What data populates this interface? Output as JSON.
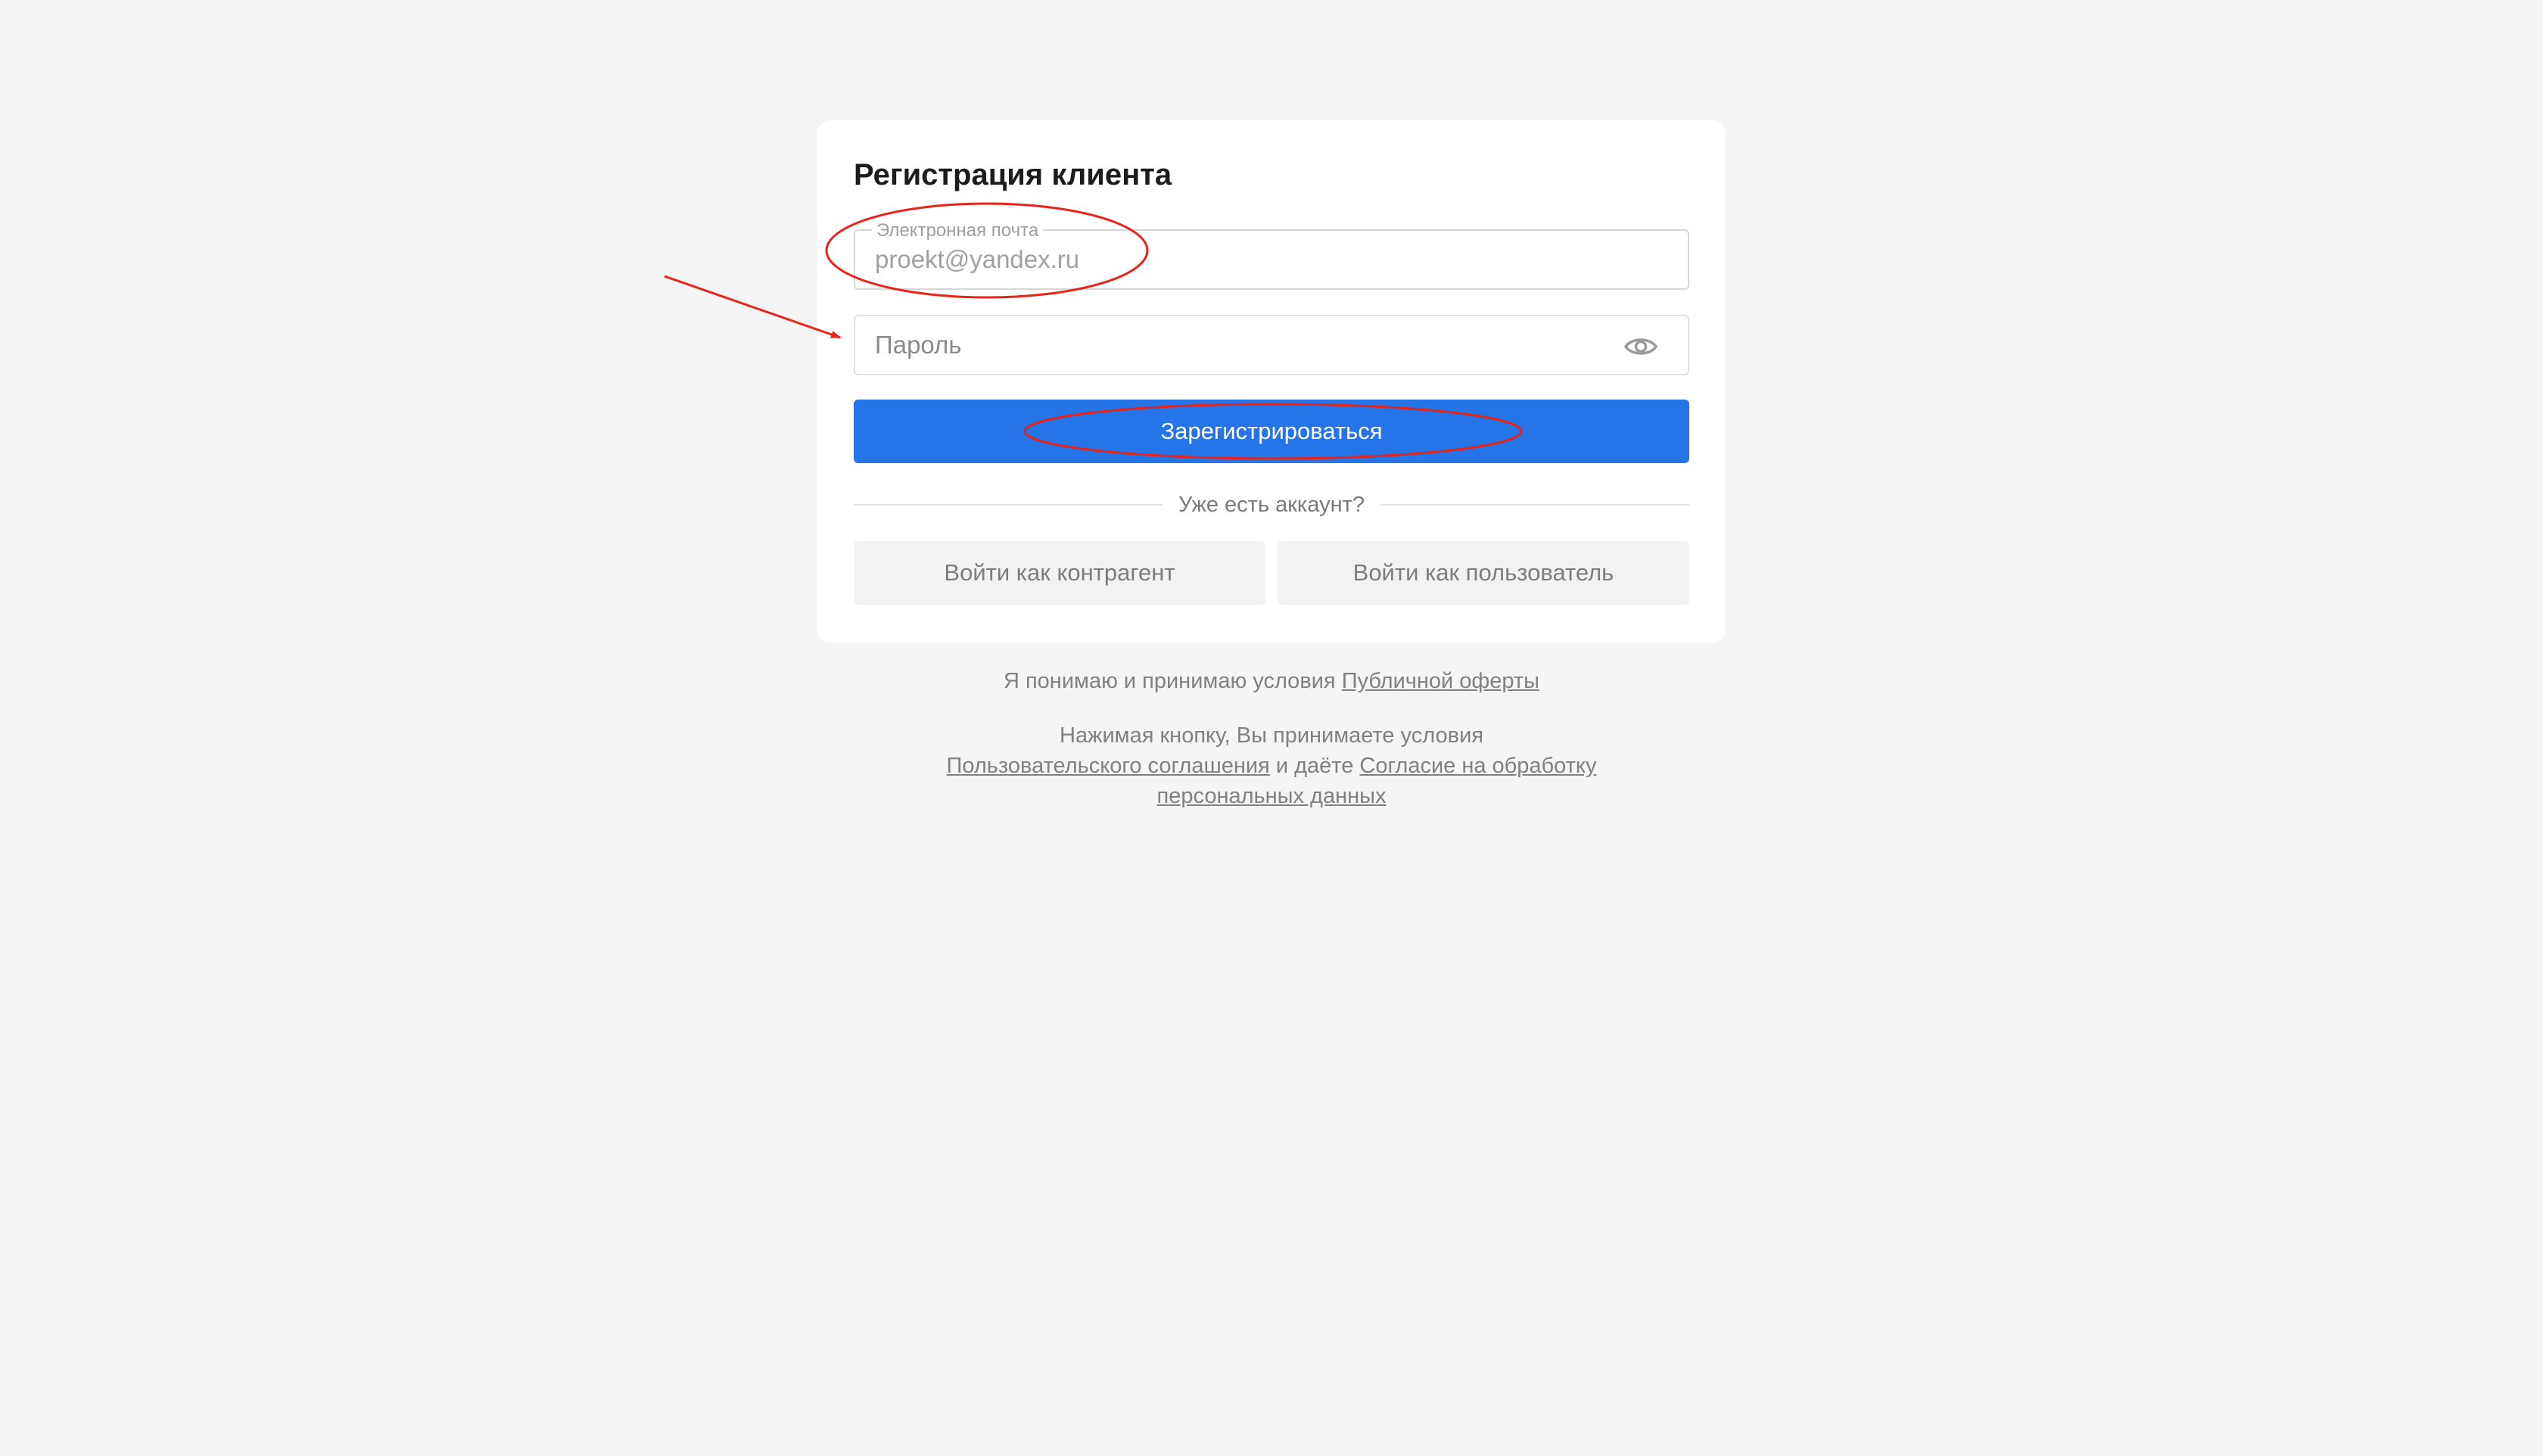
{
  "form": {
    "title": "Регистрация клиента",
    "email_label": "Электронная почта",
    "email_value": "proekt@yandex.ru",
    "password_placeholder": "Пароль",
    "register_label": "Зарегистрироваться",
    "divider_text": "Уже есть аккаунт?",
    "login_contractor_label": "Войти как контрагент",
    "login_user_label": "Войти как пользователь"
  },
  "legal": {
    "offer_prefix": "Я понимаю и принимаю условия ",
    "offer_link": "Публичной оферты",
    "agreement_prefix": "Нажимая кнопку, Вы принимаете условия ",
    "agreement_link": "Пользовательского соглашения",
    "agreement_middle": " и даёте ",
    "consent_link": "Согласие на обработку персональных данных"
  },
  "icons": {
    "password_toggle": "eye-icon"
  },
  "colors": {
    "primary": "#2575e8",
    "background": "#f5f5f5",
    "annotation": "#e8231a"
  }
}
